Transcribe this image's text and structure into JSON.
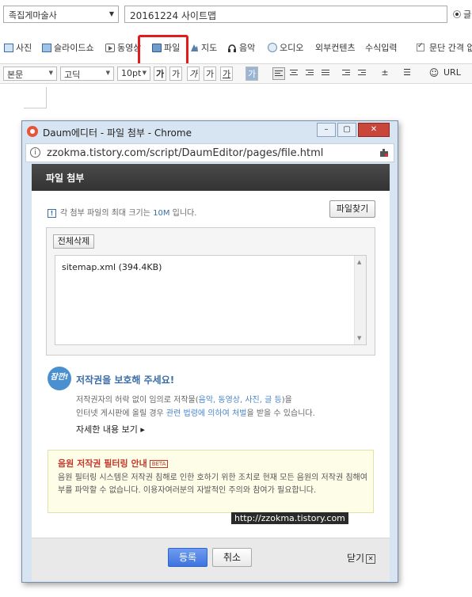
{
  "editor": {
    "category": "족집게마술사",
    "post_title": "20161224 사이트맵",
    "radio_label": "글",
    "toolbar": [
      {
        "label": "사진",
        "icon": "photo-icon"
      },
      {
        "label": "슬라이드쇼",
        "icon": "slideshow-icon"
      },
      {
        "label": "동영상",
        "icon": "video-icon"
      },
      {
        "label": "파일",
        "icon": "file-icon"
      },
      {
        "label": "지도",
        "icon": "map-icon"
      },
      {
        "label": "음악",
        "icon": "music-icon"
      },
      {
        "label": "오디오",
        "icon": "audio-icon"
      },
      {
        "label": "외부컨텐츠",
        "icon": ""
      },
      {
        "label": "수식입력",
        "icon": ""
      },
      {
        "label": "문단 간격 없",
        "icon": "checkbox-icon"
      }
    ],
    "format": {
      "paragraph": "본문",
      "font": "고딕",
      "size": "10pt",
      "bold": "가",
      "italic": "가",
      "underline": "가",
      "strike": "가",
      "color": "가",
      "url": "URL"
    },
    "highlight_color": "#e21b1b"
  },
  "popup": {
    "window_title": "Daum에디터 - 파일 첨부 - Chrome",
    "url": "zzokma.tistory.com/script/DaumEditor/pages/file.html",
    "header": "파일 첨부",
    "notice_prefix": "각 첨부 파일의 최대 크기는 ",
    "notice_size": "10M",
    "notice_suffix": " 입니다.",
    "find_button": "파일찾기",
    "delete_all_button": "전체삭제",
    "files": [
      "sitemap.xml (394.4KB)"
    ],
    "copyright": {
      "badge": "잠깐!",
      "title": "저작권을 보호해 주세요!",
      "line1_a": "저작권자의 허락 없이 임의로 저작물(",
      "line1_hl": "음악, 동영상, 사진, 글 등",
      "line1_b": ")을",
      "line2_a": "인터넷 게시판에 올릴 경우 ",
      "line2_hl": "관련 법령에 의하여 처벌",
      "line2_b": "을 받을 수 있습니다.",
      "more": "자세한 내용 보기 ▸"
    },
    "filter": {
      "title": "음원 저작권 필터링 안내",
      "beta": "BETA",
      "body": "음원 필터링 시스템은 저작권 침해로 인한 호하기 위한 조치로 현재 모든 음원의 저작권 침해여부를 파악할 수 없습니다. 이용자여러분의 자발적인 주의와 참여가 필요합니다."
    },
    "watermark": "http://zzokma.tistory.com",
    "register_button": "등록",
    "cancel_button": "취소",
    "close_button": "닫기",
    "accent": "#3e74df",
    "header_color": "#3f3f3f"
  }
}
